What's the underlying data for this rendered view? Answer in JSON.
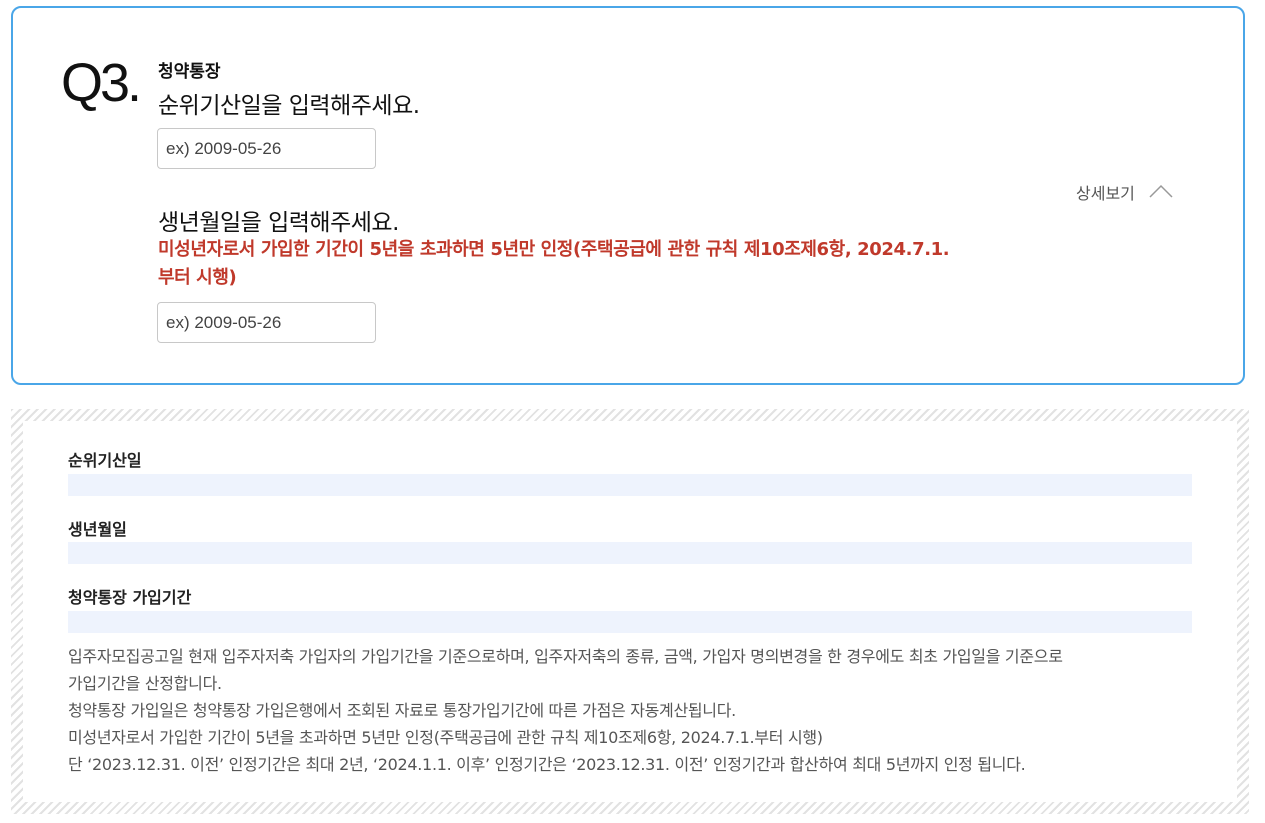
{
  "question": {
    "number": "Q3.",
    "category": "청약통장",
    "q1_title": "순위기산일을 입력해주세요.",
    "q1_placeholder": "ex) 2009-05-26",
    "q2_title": "생년월일을 입력해주세요.",
    "q2_note": "미성년자로서 가입한 기간이 5년을 초과하면 5년만 인정(주택공급에 관한 규칙 제10조제6항, 2024.7.1.부터 시행)",
    "q2_placeholder": "ex) 2009-05-26",
    "detail_label": "상세보기",
    "detail_icon": "chevron-up-icon"
  },
  "result": {
    "rows": [
      {
        "label": "순위기산일",
        "value": ""
      },
      {
        "label": "생년월일",
        "value": ""
      },
      {
        "label": "청약통장 가입기간",
        "value": ""
      }
    ],
    "description_lines": [
      "입주자모집공고일 현재 입주자저축 가입자의 가입기간을 기준으로하며, 입주자저축의 종류, 금액, 가입자 명의변경을 한 경우에도 최초 가입일을 기준으로",
      "가입기간을 산정합니다.",
      "청약통장 가입일은 청약통장 가입은행에서 조회된 자료로 통장가입기간에 따른 가점은 자동계산됩니다.",
      "미성년자로서 가입한 기간이 5년을 초과하면 5년만 인정(주택공급에 관한 규칙 제10조제6항, 2024.7.1.부터 시행)",
      "단 ‘2023.12.31. 이전’ 인정기간은 최대 2년, ‘2024.1.1. 이후’ 인정기간은 ‘2023.12.31. 이전’ 인정기간과 합산하여 최대 5년까지 인정 됩니다."
    ]
  },
  "colors": {
    "card_border": "#4aa6e8",
    "note_red": "#c0392b",
    "bar_bg": "#eef3fd"
  }
}
